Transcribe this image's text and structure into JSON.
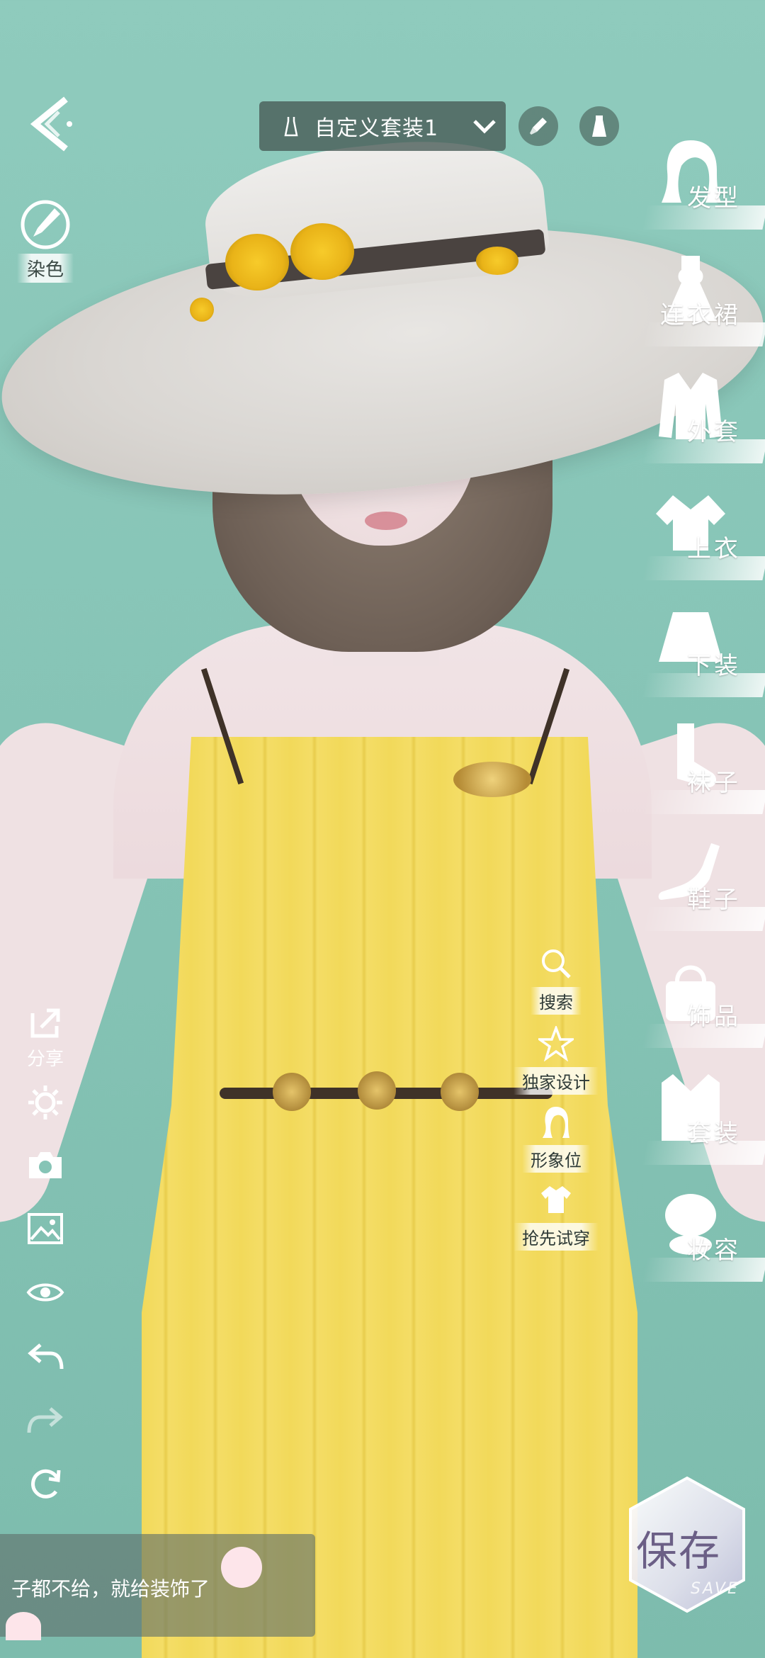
{
  "header": {
    "back_icon": "back-arrow-icon",
    "outfit_name": "自定义套装1",
    "outfit_icon": "dress-outline-icon",
    "dropdown_icon": "chevron-down-icon",
    "brush_icon": "paintbrush-icon",
    "outfit_toggle_icon": "dress-icon"
  },
  "dye": {
    "label": "染色",
    "icon": "palette-brush-icon"
  },
  "categories": [
    {
      "label": "发型",
      "icon": "hair-icon"
    },
    {
      "label": "连衣裙",
      "icon": "dress-icon"
    },
    {
      "label": "外套",
      "icon": "coat-icon"
    },
    {
      "label": "上衣",
      "icon": "top-icon"
    },
    {
      "label": "下装",
      "icon": "skirt-icon"
    },
    {
      "label": "袜子",
      "icon": "socks-icon"
    },
    {
      "label": "鞋子",
      "icon": "shoe-icon"
    },
    {
      "label": "饰品",
      "icon": "bag-icon"
    },
    {
      "label": "套装",
      "icon": "suit-icon"
    },
    {
      "label": "妆容",
      "icon": "makeup-icon"
    }
  ],
  "quick_actions": [
    {
      "label": "搜索",
      "icon": "search-icon"
    },
    {
      "label": "独家设计",
      "icon": "star-icon"
    },
    {
      "label": "形象位",
      "icon": "profile-icon"
    },
    {
      "label": "抢先试穿",
      "icon": "tshirt-icon"
    }
  ],
  "side_tools": {
    "share_label": "分享",
    "icons": [
      "share-icon",
      "settings-icon",
      "camera-icon",
      "image-icon",
      "eye-icon",
      "undo-icon",
      "redo-icon",
      "reset-icon"
    ]
  },
  "chat": {
    "text": "子都不给，就给装饰了"
  },
  "save": {
    "label": "保存",
    "sub": "SAVE"
  }
}
